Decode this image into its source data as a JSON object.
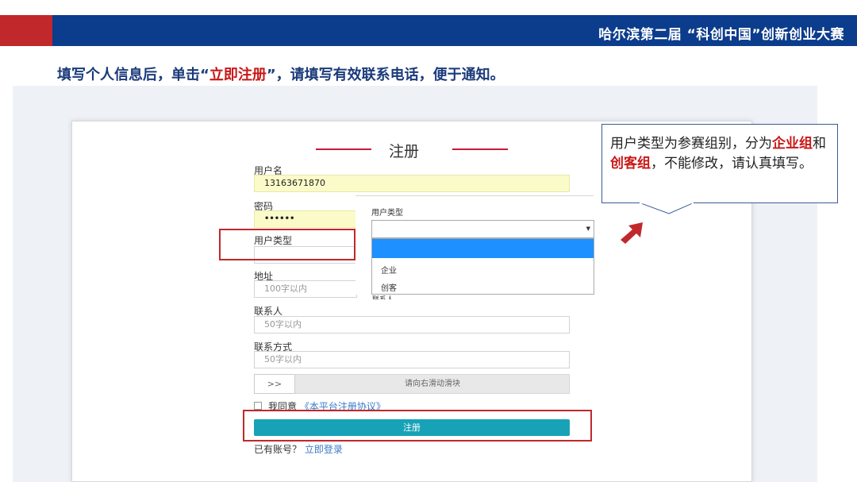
{
  "header": {
    "title": "哈尔滨第二届 “科创中国”创新创业大赛"
  },
  "instruction": {
    "part1": "填写个人信息后，单击“",
    "highlight": "立即注册",
    "part2": "”，请填写有效联系电话，便于通知。"
  },
  "form": {
    "title": "注册",
    "username_label": "用户名",
    "username_value": "13163671870",
    "password_label": "密码",
    "password_value": "••••••",
    "user_type_label": "用户类型",
    "address_label": "地址",
    "address_placeholder": "100字以内",
    "contact_label": "联系人",
    "contact_placeholder": "50字以内",
    "contact_method_label": "联系方式",
    "contact_method_placeholder": "50字以内",
    "slider_handle": ">>",
    "slider_text": "请向右滑动滑块",
    "agree_text": "我同意",
    "agree_link": "《本平台注册协议》",
    "register_button": "注册",
    "have_account": "已有账号？",
    "login_link": "立即登录"
  },
  "dropdown": {
    "label": "用户类型",
    "caret": "▼",
    "options": [
      "",
      "企业",
      "创客"
    ],
    "peek_label": "联系人"
  },
  "callout": {
    "text1": "用户类型为参赛组别，分为",
    "red1": "企业组",
    "text2": "和",
    "red2": "创客组",
    "text3": "，不能修改，请认真填写。"
  },
  "colors": {
    "header_blue": "#0c3c8c",
    "header_red": "#c0282c",
    "highlight_red": "#c81818",
    "button_teal": "#17a2b8",
    "selected_option": "#1e90ff"
  }
}
